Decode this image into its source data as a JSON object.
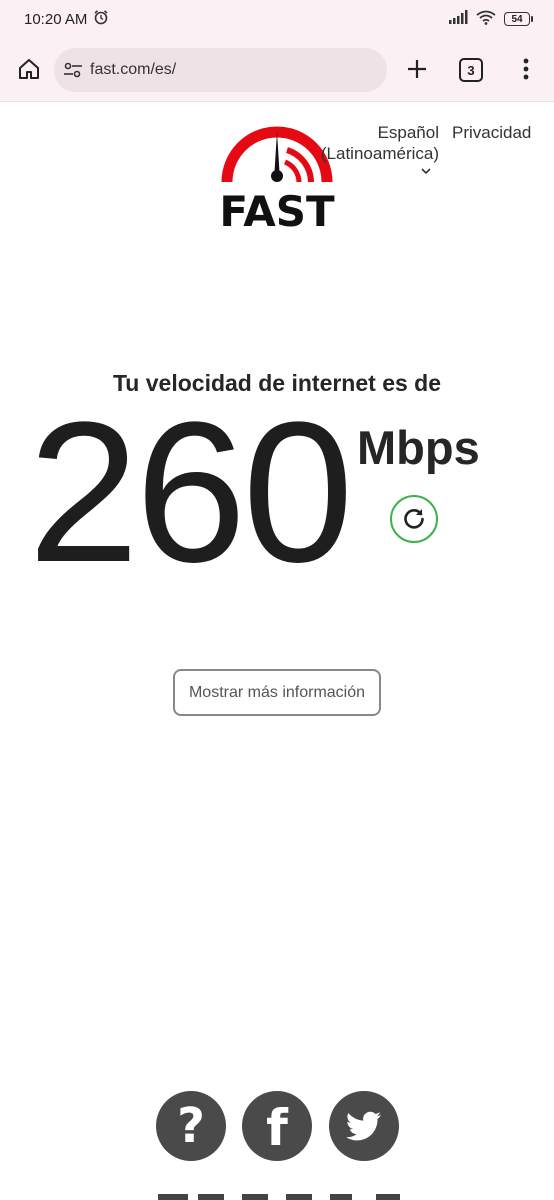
{
  "status_bar": {
    "time": "10:20 AM",
    "battery": "54"
  },
  "browser": {
    "url": "fast.com/es/",
    "tab_count": "3"
  },
  "header": {
    "logo_text": "FAST",
    "language_line1": "Español",
    "language_line2": "(Latinoamérica)",
    "privacy": "Privacidad"
  },
  "speed": {
    "caption": "Tu velocidad de internet es de",
    "value": "260",
    "units": "Mbps"
  },
  "more_info_label": "Mostrar más información",
  "colors": {
    "brand_red": "#e50914",
    "refresh_green": "#3db24b",
    "social_gray": "#4a4a4a"
  }
}
